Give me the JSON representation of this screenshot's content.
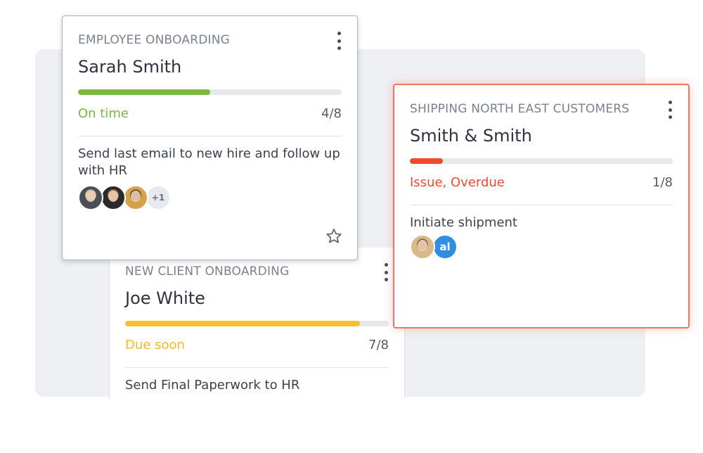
{
  "cards": {
    "employee": {
      "category": "EMPLOYEE ONBOARDING",
      "name": "Sarah Smith",
      "progress": 0.5,
      "status": "On time",
      "count": "4/8",
      "task": "Send last email to new hire and follow up with HR",
      "avatars": [
        {
          "type": "photo",
          "icon": "person-avatar-1"
        },
        {
          "type": "photo",
          "icon": "person-avatar-2"
        },
        {
          "type": "photo",
          "icon": "person-avatar-3"
        },
        {
          "type": "more",
          "label": "+1"
        }
      ],
      "status_color": "#7ab83f",
      "accent": "#7ab83f"
    },
    "client": {
      "category": "NEW CLIENT ONBOARDING",
      "name": "Joe White",
      "progress": 0.89,
      "status": "Due soon",
      "count": "7/8",
      "task": "Send Final Paperwork to HR",
      "status_color": "#f4b82a",
      "accent": "#f6c12a"
    },
    "shipping": {
      "category": "SHIPPING NORTH EAST CUSTOMERS",
      "name": "Smith & Smith",
      "progress": 0.125,
      "status": "Issue, Overdue",
      "count": "1/8",
      "task": "Initiate shipment",
      "avatars": [
        {
          "type": "photo",
          "icon": "person-avatar-4"
        },
        {
          "type": "initials",
          "label": "al"
        }
      ],
      "status_color": "#ee4a2e",
      "accent": "#ee4a2e"
    }
  },
  "icons": [
    "more-vertical-icon",
    "star-icon"
  ]
}
